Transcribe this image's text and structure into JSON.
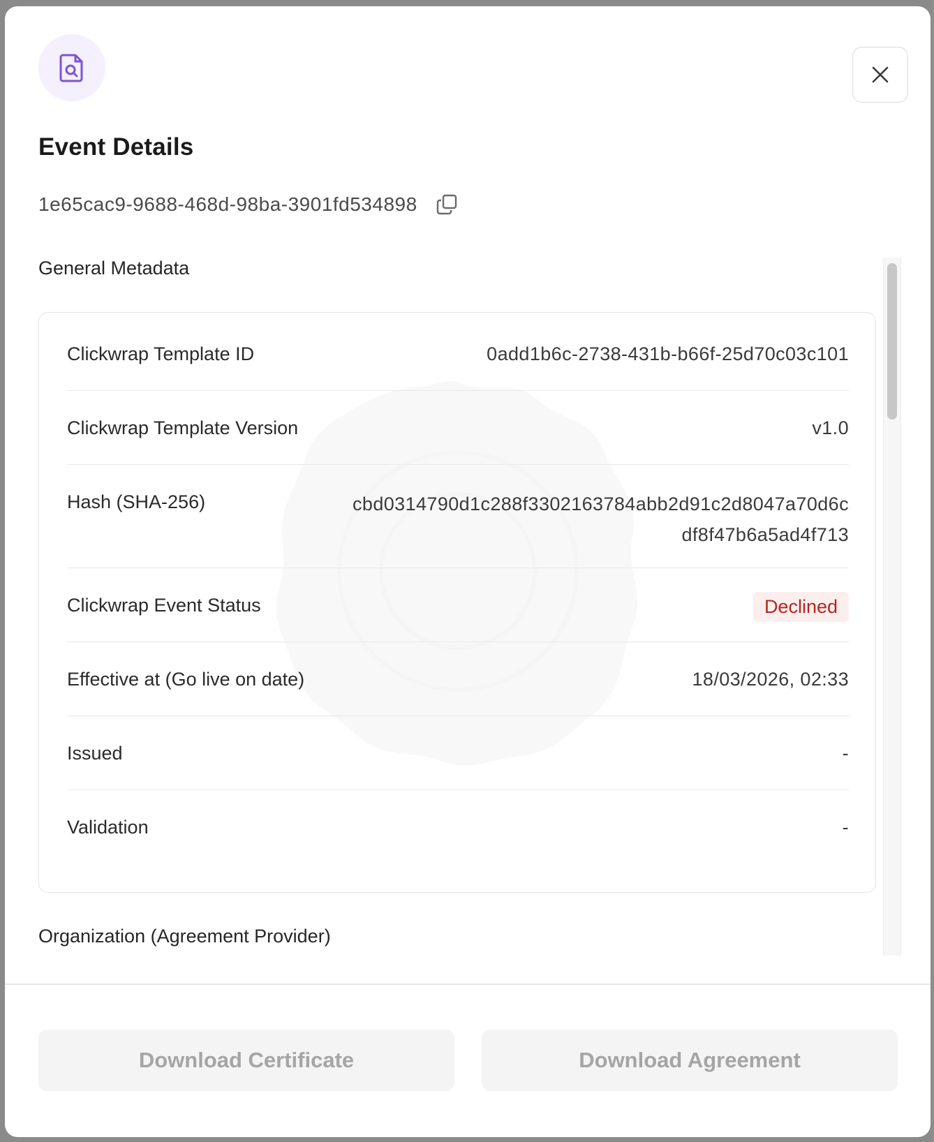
{
  "modal": {
    "title": "Event Details",
    "event_id": "1e65cac9-9688-468d-98ba-3901fd534898",
    "icons": {
      "header": "document-search-icon",
      "close": "close-icon",
      "copy": "copy-icon"
    }
  },
  "general_metadata": {
    "heading": "General Metadata",
    "rows": [
      {
        "label": "Clickwrap Template ID",
        "value": "0add1b6c-2738-431b-b66f-25d70c03c101"
      },
      {
        "label": "Clickwrap Template Version",
        "value": "v1.0"
      },
      {
        "label": "Hash (SHA-256)",
        "value": "cbd0314790d1c288f3302163784abb2d91c2d8047a70d6cdf8f47b6a5ad4f713"
      },
      {
        "label": "Clickwrap Event Status",
        "value": "Declined"
      },
      {
        "label": "Effective at (Go live on date)",
        "value": "18/03/2026, 02:33"
      },
      {
        "label": "Issued",
        "value": "-"
      },
      {
        "label": "Validation",
        "value": "-"
      }
    ]
  },
  "organization": {
    "heading": "Organization (Agreement Provider)"
  },
  "footer": {
    "download_certificate": "Download Certificate",
    "download_agreement": "Download Agreement"
  },
  "colors": {
    "accent": "#7b55d6",
    "status_declined_text": "#b3261e",
    "status_declined_bg": "#fdeeee",
    "disabled_button_bg": "#f4f4f4",
    "disabled_button_text": "#a5a5a5"
  }
}
